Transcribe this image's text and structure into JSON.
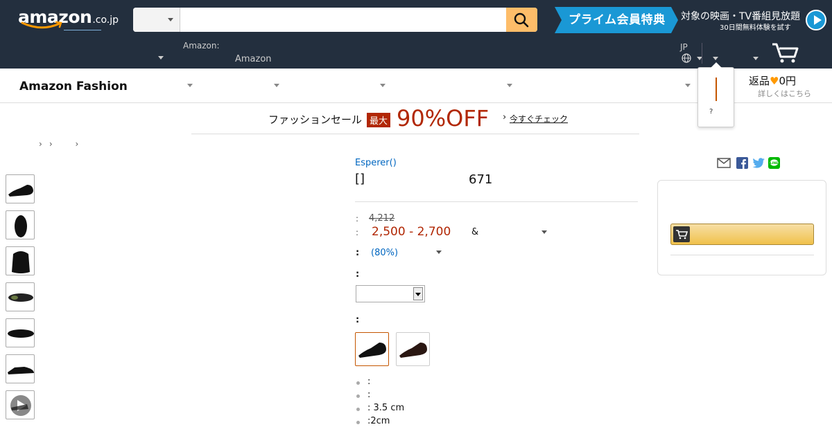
{
  "header": {
    "logo_text": "amazon",
    "logo_suffix": ".co.jp",
    "search_placeholder": "",
    "prime": {
      "tag": "プライム会員特典",
      "title": "対象の映画・TV番組見放題",
      "subtitle": "30日間無料体験を試す"
    },
    "deliver_label": "Amazon:",
    "deliver_value": "Amazon",
    "lang_label": "JP"
  },
  "subnav": {
    "title": "Amazon Fashion",
    "returns_label": "返品",
    "returns_value": "0円",
    "returns_sub": "詳しくはこちら"
  },
  "popup": {
    "question": "?"
  },
  "sale": {
    "text": "ファッションセール",
    "max": "最大",
    "off": "90%OFF",
    "check": "今すぐチェック"
  },
  "product": {
    "brand": "Esperer()",
    "title": "[]",
    "rating_count": "671",
    "ref_label": ":",
    "ref_price": "4,212",
    "price_label": ":",
    "price": "2,500 -  2,700",
    "amp": "&",
    "off_label": ":",
    "off_value": "(80%)",
    "size_label": ":",
    "color_label": ":",
    "bullets": [
      ":",
      ":",
      ": 3.5 cm",
      ":2cm"
    ]
  },
  "thumbnails": [
    "shoe-side",
    "shoe-front",
    "shoe-back",
    "shoe-sole",
    "shoe-top",
    "shoe-side-2",
    "video"
  ],
  "colors": {
    "nav_bg": "#232f3e",
    "search_btn": "#febd69",
    "prime_blue": "#1a98d5",
    "price_red": "#b12704",
    "link_blue": "#0066c0",
    "selected_border": "#c45500"
  }
}
